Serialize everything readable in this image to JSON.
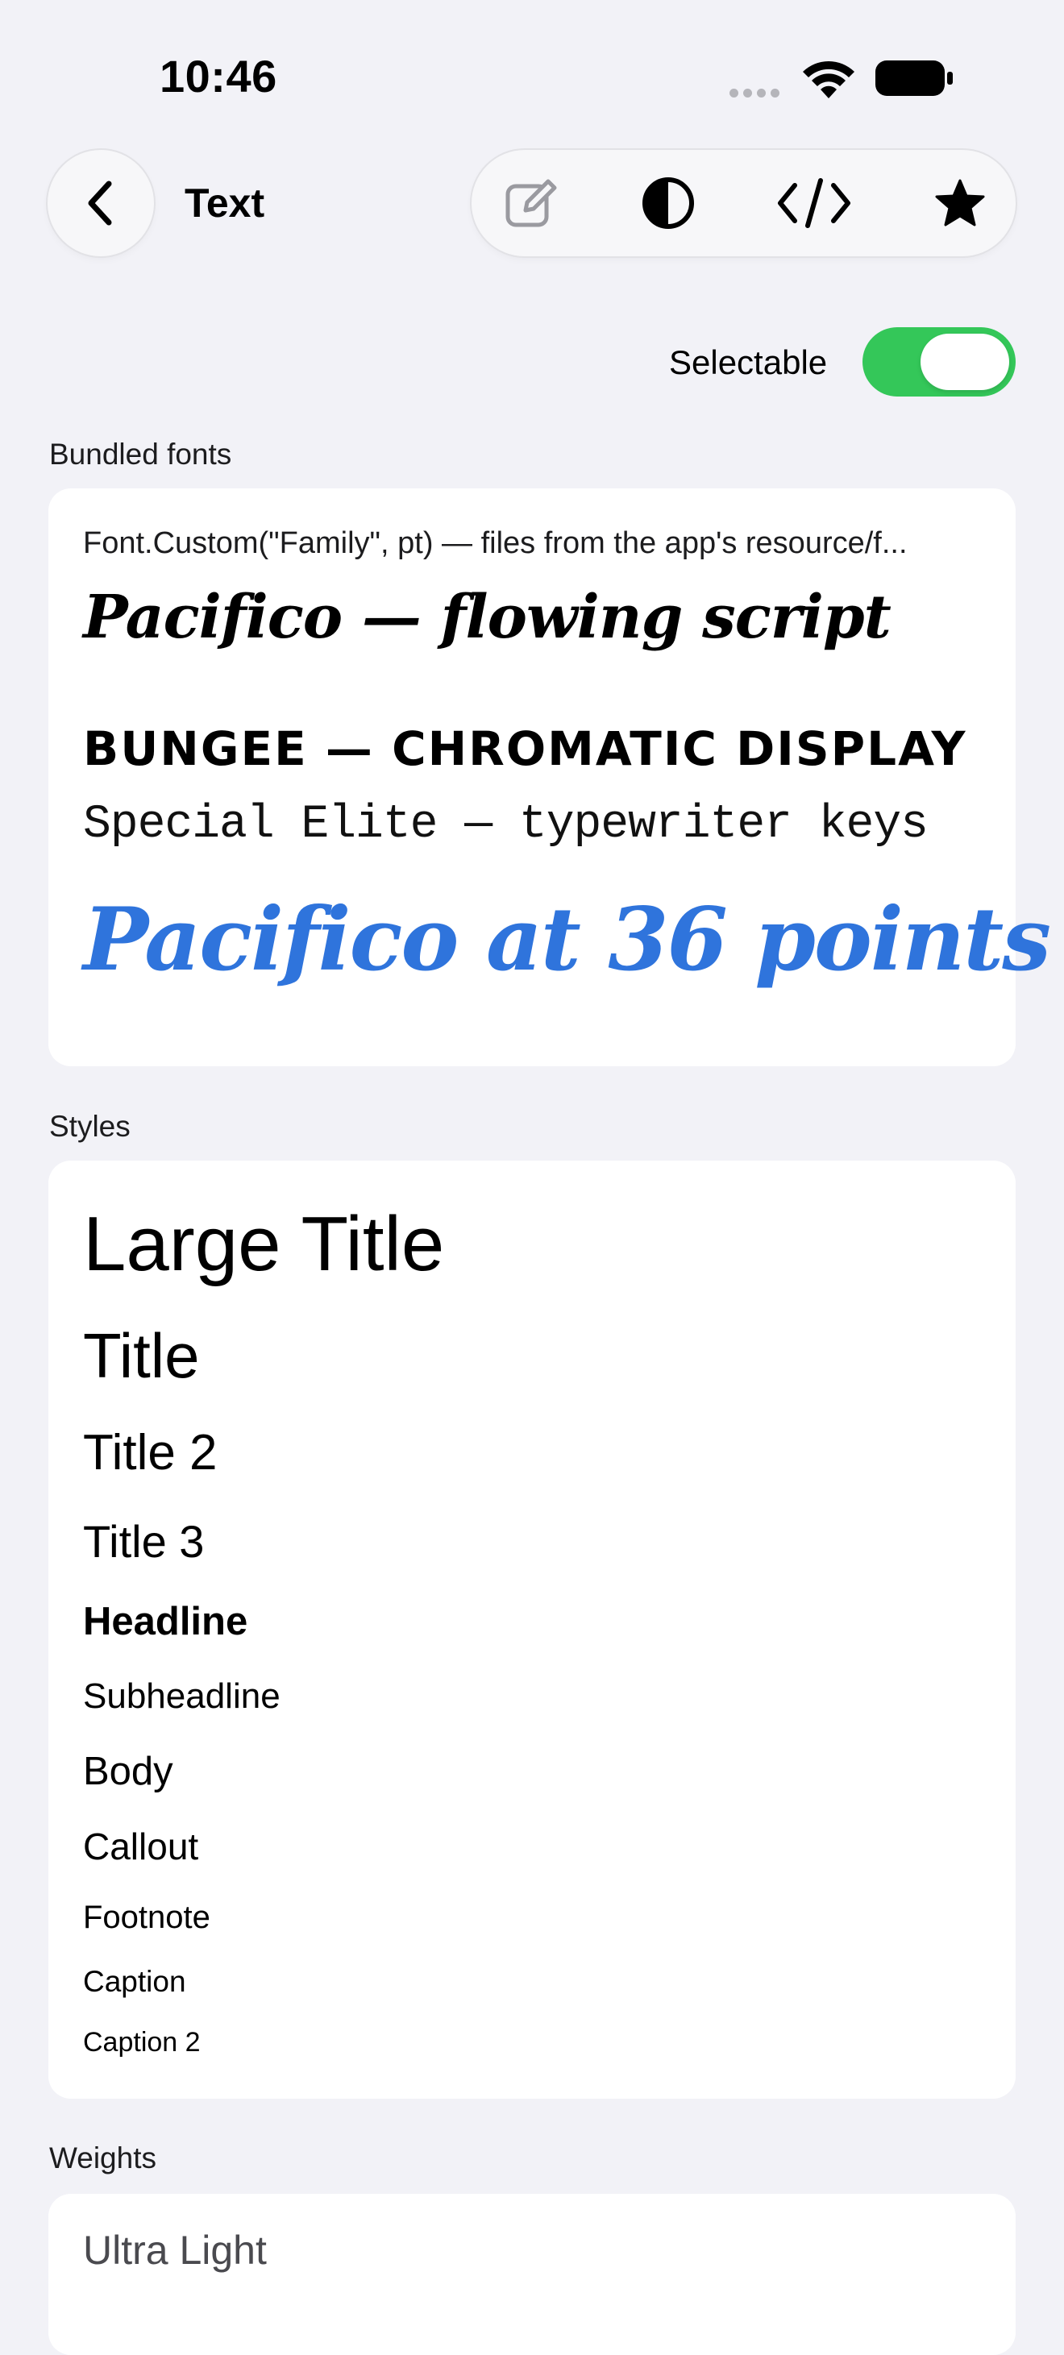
{
  "status_bar": {
    "time": "10:46",
    "icons": [
      "signal-dots-icon",
      "wifi-icon",
      "battery-icon"
    ]
  },
  "nav": {
    "title": "Text",
    "back_icon": "chevron-left-icon",
    "toolbar": [
      "edit-icon",
      "contrast-icon",
      "code-icon",
      "star-icon"
    ]
  },
  "toggle": {
    "label": "Selectable",
    "on": true,
    "color": "#34c759"
  },
  "bundled_fonts": {
    "header": "Bundled fonts",
    "description": "Font.Custom(\"Family\", pt) — files from the app's resource/f...",
    "samples": [
      "Pacifico — flowing script",
      "BUNGEE — CHROMATIC DISPLAY",
      "Special Elite — typewriter keys"
    ],
    "large_sample": "Pacifico at 36 points",
    "large_sample_color": "#2f74dc"
  },
  "styles": {
    "header": "Styles",
    "items": [
      "Large Title",
      "Title",
      "Title 2",
      "Title 3",
      "Headline",
      "Subheadline",
      "Body",
      "Callout",
      "Footnote",
      "Caption",
      "Caption 2"
    ]
  },
  "weights": {
    "header": "Weights",
    "items": [
      "Ultra Light"
    ]
  }
}
